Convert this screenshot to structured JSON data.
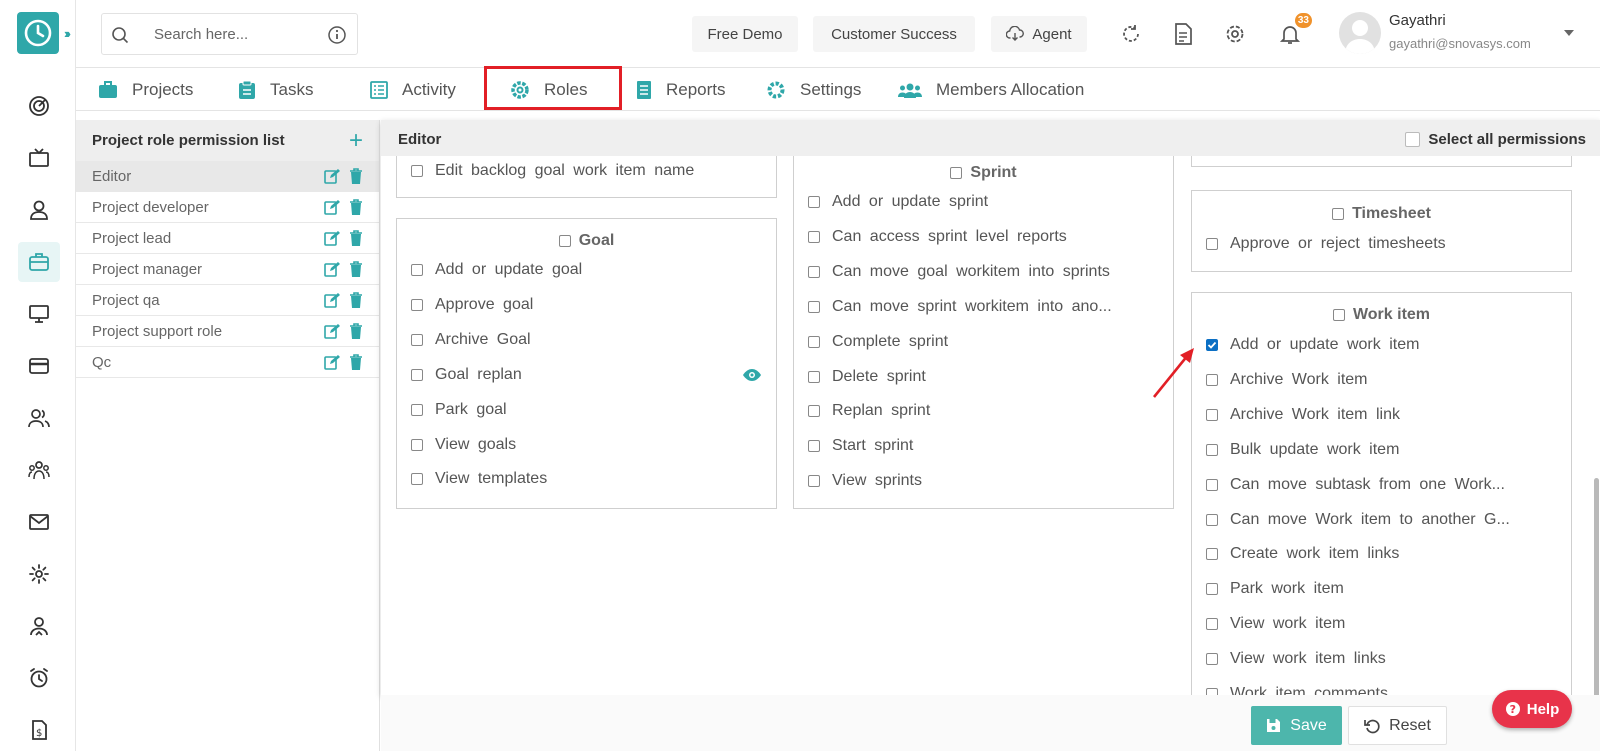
{
  "search": {
    "placeholder": "Search here..."
  },
  "topbar": {
    "free_demo": "Free Demo",
    "customer_success": "Customer Success",
    "agent": "Agent",
    "notification_count": "33",
    "user_name": "Gayathri",
    "user_email": "gayathri@snovasys.com"
  },
  "tabs": [
    {
      "label": "Projects",
      "icon": "briefcase-icon"
    },
    {
      "label": "Tasks",
      "icon": "clipboard-icon"
    },
    {
      "label": "Activity",
      "icon": "list-icon"
    },
    {
      "label": "Roles",
      "icon": "gear-icon"
    },
    {
      "label": "Reports",
      "icon": "document-icon"
    },
    {
      "label": "Settings",
      "icon": "gear-icon"
    },
    {
      "label": "Members Allocation",
      "icon": "users-icon"
    }
  ],
  "role_list": {
    "title": "Project role permission list",
    "roles": [
      "Editor",
      "Project developer",
      "Project lead",
      "Project manager",
      "Project qa",
      "Project support role",
      "Qc"
    ]
  },
  "editor": {
    "title": "Editor",
    "select_all": "Select all permissions",
    "top_left_item": "Edit backlog goal work item name",
    "goal": {
      "title": "Goal",
      "items": [
        "Add or update goal",
        "Approve goal",
        "Archive Goal",
        "Goal replan",
        "Park goal",
        "View goals",
        "View templates"
      ]
    },
    "sprint": {
      "title": "Sprint",
      "items": [
        "Add or update sprint",
        "Can access sprint level reports",
        "Can move goal workitem into sprints",
        "Can move sprint workitem into ano...",
        "Complete sprint",
        "Delete sprint",
        "Replan sprint",
        "Start sprint",
        "View sprints"
      ]
    },
    "timesheet": {
      "title": "Timesheet",
      "items": [
        "Approve or reject timesheets"
      ]
    },
    "work_item": {
      "title": "Work item",
      "items": [
        "Add or update work item",
        "Archive Work item",
        "Archive Work item link",
        "Bulk update work item",
        "Can move subtask from one Work...",
        "Can move Work item to another G...",
        "Create work item links",
        "Park work item",
        "View work item",
        "View work item links",
        "Work item comments"
      ],
      "checked_index": 0
    }
  },
  "footer": {
    "save": "Save",
    "reset": "Reset",
    "help": "Help"
  },
  "colors": {
    "accent": "#2fa7a9",
    "highlight": "#e21f26",
    "checkbox": "#0b6fc4"
  }
}
